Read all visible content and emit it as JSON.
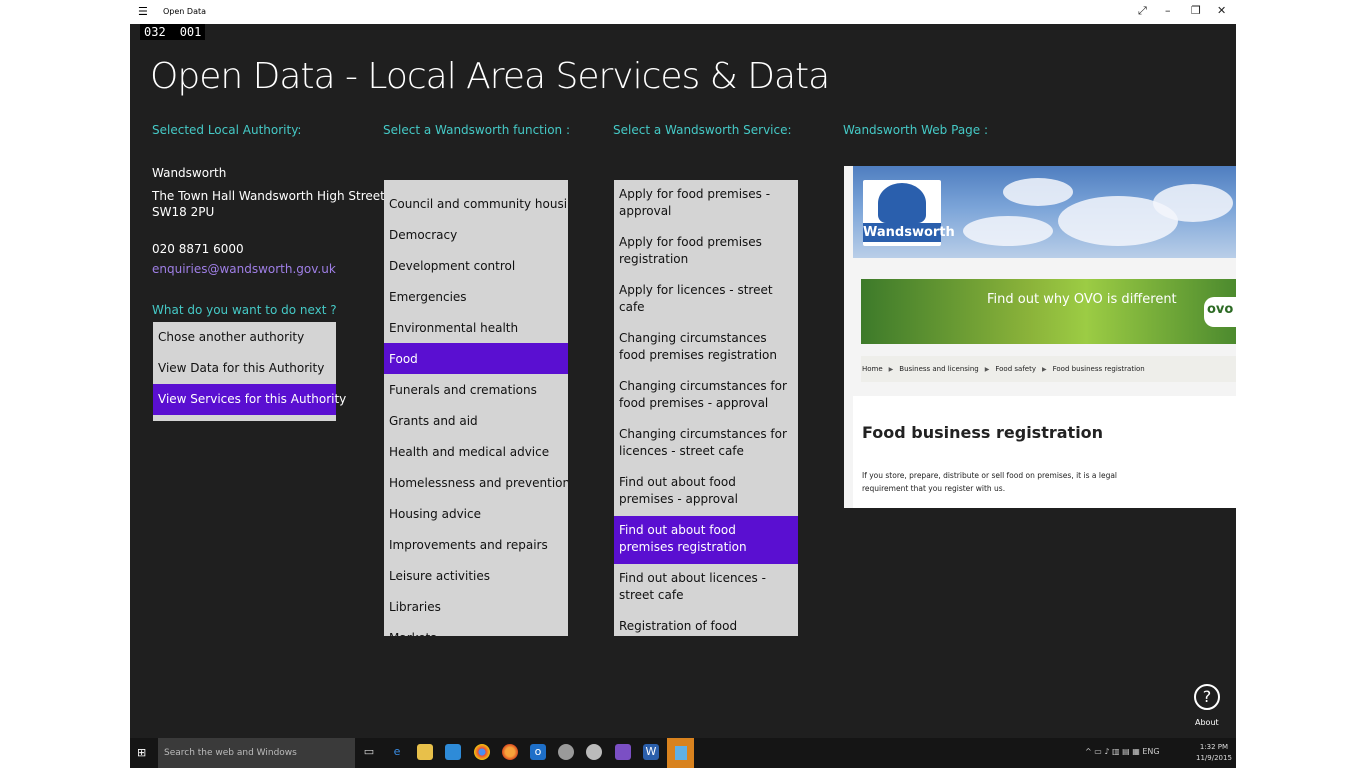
{
  "window": {
    "title": "Open Data",
    "frame_left": "032",
    "frame_right": "001"
  },
  "app_title": "Open Data - Local Area Services & Data",
  "headers": {
    "authority": "Selected Local Authority:",
    "function": "Select a Wandsworth function :",
    "service": "Select a Wandsworth Service:",
    "webpage": "Wandsworth Web Page :"
  },
  "authority": {
    "name": "Wandsworth",
    "address1": "The Town Hall Wandsworth High Street",
    "address2": "SW18 2PU",
    "phone": "020 8871 6000",
    "email": "enquiries@wandsworth.gov.uk"
  },
  "next": {
    "header": "What do you want to do next ?",
    "items": [
      "Chose another authority",
      "View Data for this Authority",
      "View Services for this Authority"
    ],
    "selected": 2
  },
  "functions": {
    "items": [
      "Council and community housing",
      "Democracy",
      "Development control",
      "Emergencies",
      "Environmental health",
      "Food",
      "Funerals and cremations",
      "Grants and aid",
      "Health and medical advice",
      "Homelessness and prevention",
      "Housing advice",
      "Improvements and repairs",
      "Leisure activities",
      "Libraries",
      "Markets"
    ],
    "selected": 5
  },
  "services": {
    "items": [
      "Apply for food premises - approval",
      "Apply for food premises registration",
      "Apply for licences - street cafe",
      "Changing circumstances food premises registration",
      "Changing circumstances for food premises - approval",
      "Changing circumstances for licences - street cafe",
      "Find out about food premises - approval",
      "Find out about food premises registration",
      "Find out about licences - street cafe",
      "Registration of food premises registration"
    ],
    "selected": 7
  },
  "webpage": {
    "logo_text": "Wandsworth",
    "ad_text": "Find out why OVO is different",
    "ad_brand": "ovo",
    "breadcrumbs": [
      "Home",
      "Business and licensing",
      "Food safety",
      "Food business registration"
    ],
    "heading": "Food business registration",
    "body": "If you store, prepare, distribute or sell food on premises, it is a legal requirement that you register with us."
  },
  "about": {
    "label": "About",
    "icon": "question-icon"
  },
  "taskbar": {
    "search_placeholder": "Search the web and Windows",
    "lang": "ENG",
    "time": "1:32 PM",
    "date": "11/9/2015"
  },
  "colors": {
    "accent": "#5a0fd1",
    "header": "#45c9c6",
    "link": "#9f7fe6",
    "bg": "#1f1f1f"
  }
}
